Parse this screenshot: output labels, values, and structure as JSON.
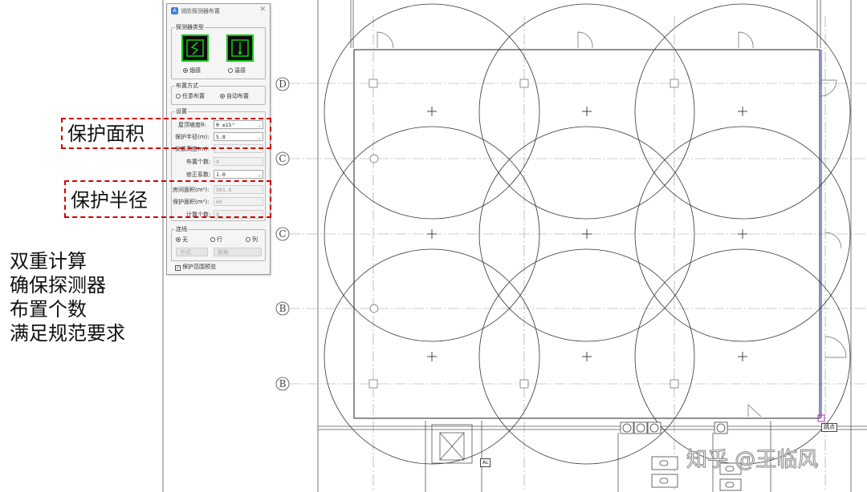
{
  "left_notes": [
    "双重计算",
    "确保探测器",
    "布置个数",
    "满足规范要求"
  ],
  "callouts": {
    "area_label": "保护面积",
    "radius_label": "保护半径"
  },
  "dialog": {
    "title": "消防探测器布置",
    "icon_letter": "A",
    "close_glyph": "✕",
    "detector_group_label": "探测器类型",
    "smoke_label": "烟感",
    "heat_label": "温感",
    "detector_selected": "smoke",
    "layout_group_label": "布置方式",
    "layout_free": "任意布置",
    "layout_auto": "自动布置",
    "layout_selected": "auto",
    "settings_group_label": "设置",
    "roof_slope_label": "屋顶坡度θ:",
    "roof_slope_value": "θ ≤15°",
    "radius_label": "保护半径(m):",
    "radius_value": "5.8",
    "install_height_label": "安装高度(m):",
    "install_height_value": "",
    "count_label": "布置个数:",
    "count_value": "9",
    "correction_label": "修正系数:",
    "correction_value": "1.0",
    "room_area_label": "房间面积(m²):",
    "room_area_value": "501.6",
    "protect_area_label": "保护面积(m²):",
    "protect_area_value": "60",
    "calc_count_label": "计算个数:",
    "calc_count_value": "9",
    "connect_group_label": "连线",
    "connect_none": "无",
    "connect_row": "行",
    "connect_col": "列",
    "connect_selected": "none",
    "btn_dis1": "方式",
    "btn_dis2": "倒角",
    "show_range_label": "保护范围预览",
    "show_range_checked": true
  },
  "drawing": {
    "axis_labels": [
      "D",
      "C",
      "C",
      "B",
      "B"
    ],
    "tag_text": "跳点",
    "small_tag": "AL"
  },
  "watermark": "知乎 @王临风",
  "colors": {
    "callout": "#d40000",
    "detector_border": "#14c814",
    "blue_line": "#3355cc"
  }
}
